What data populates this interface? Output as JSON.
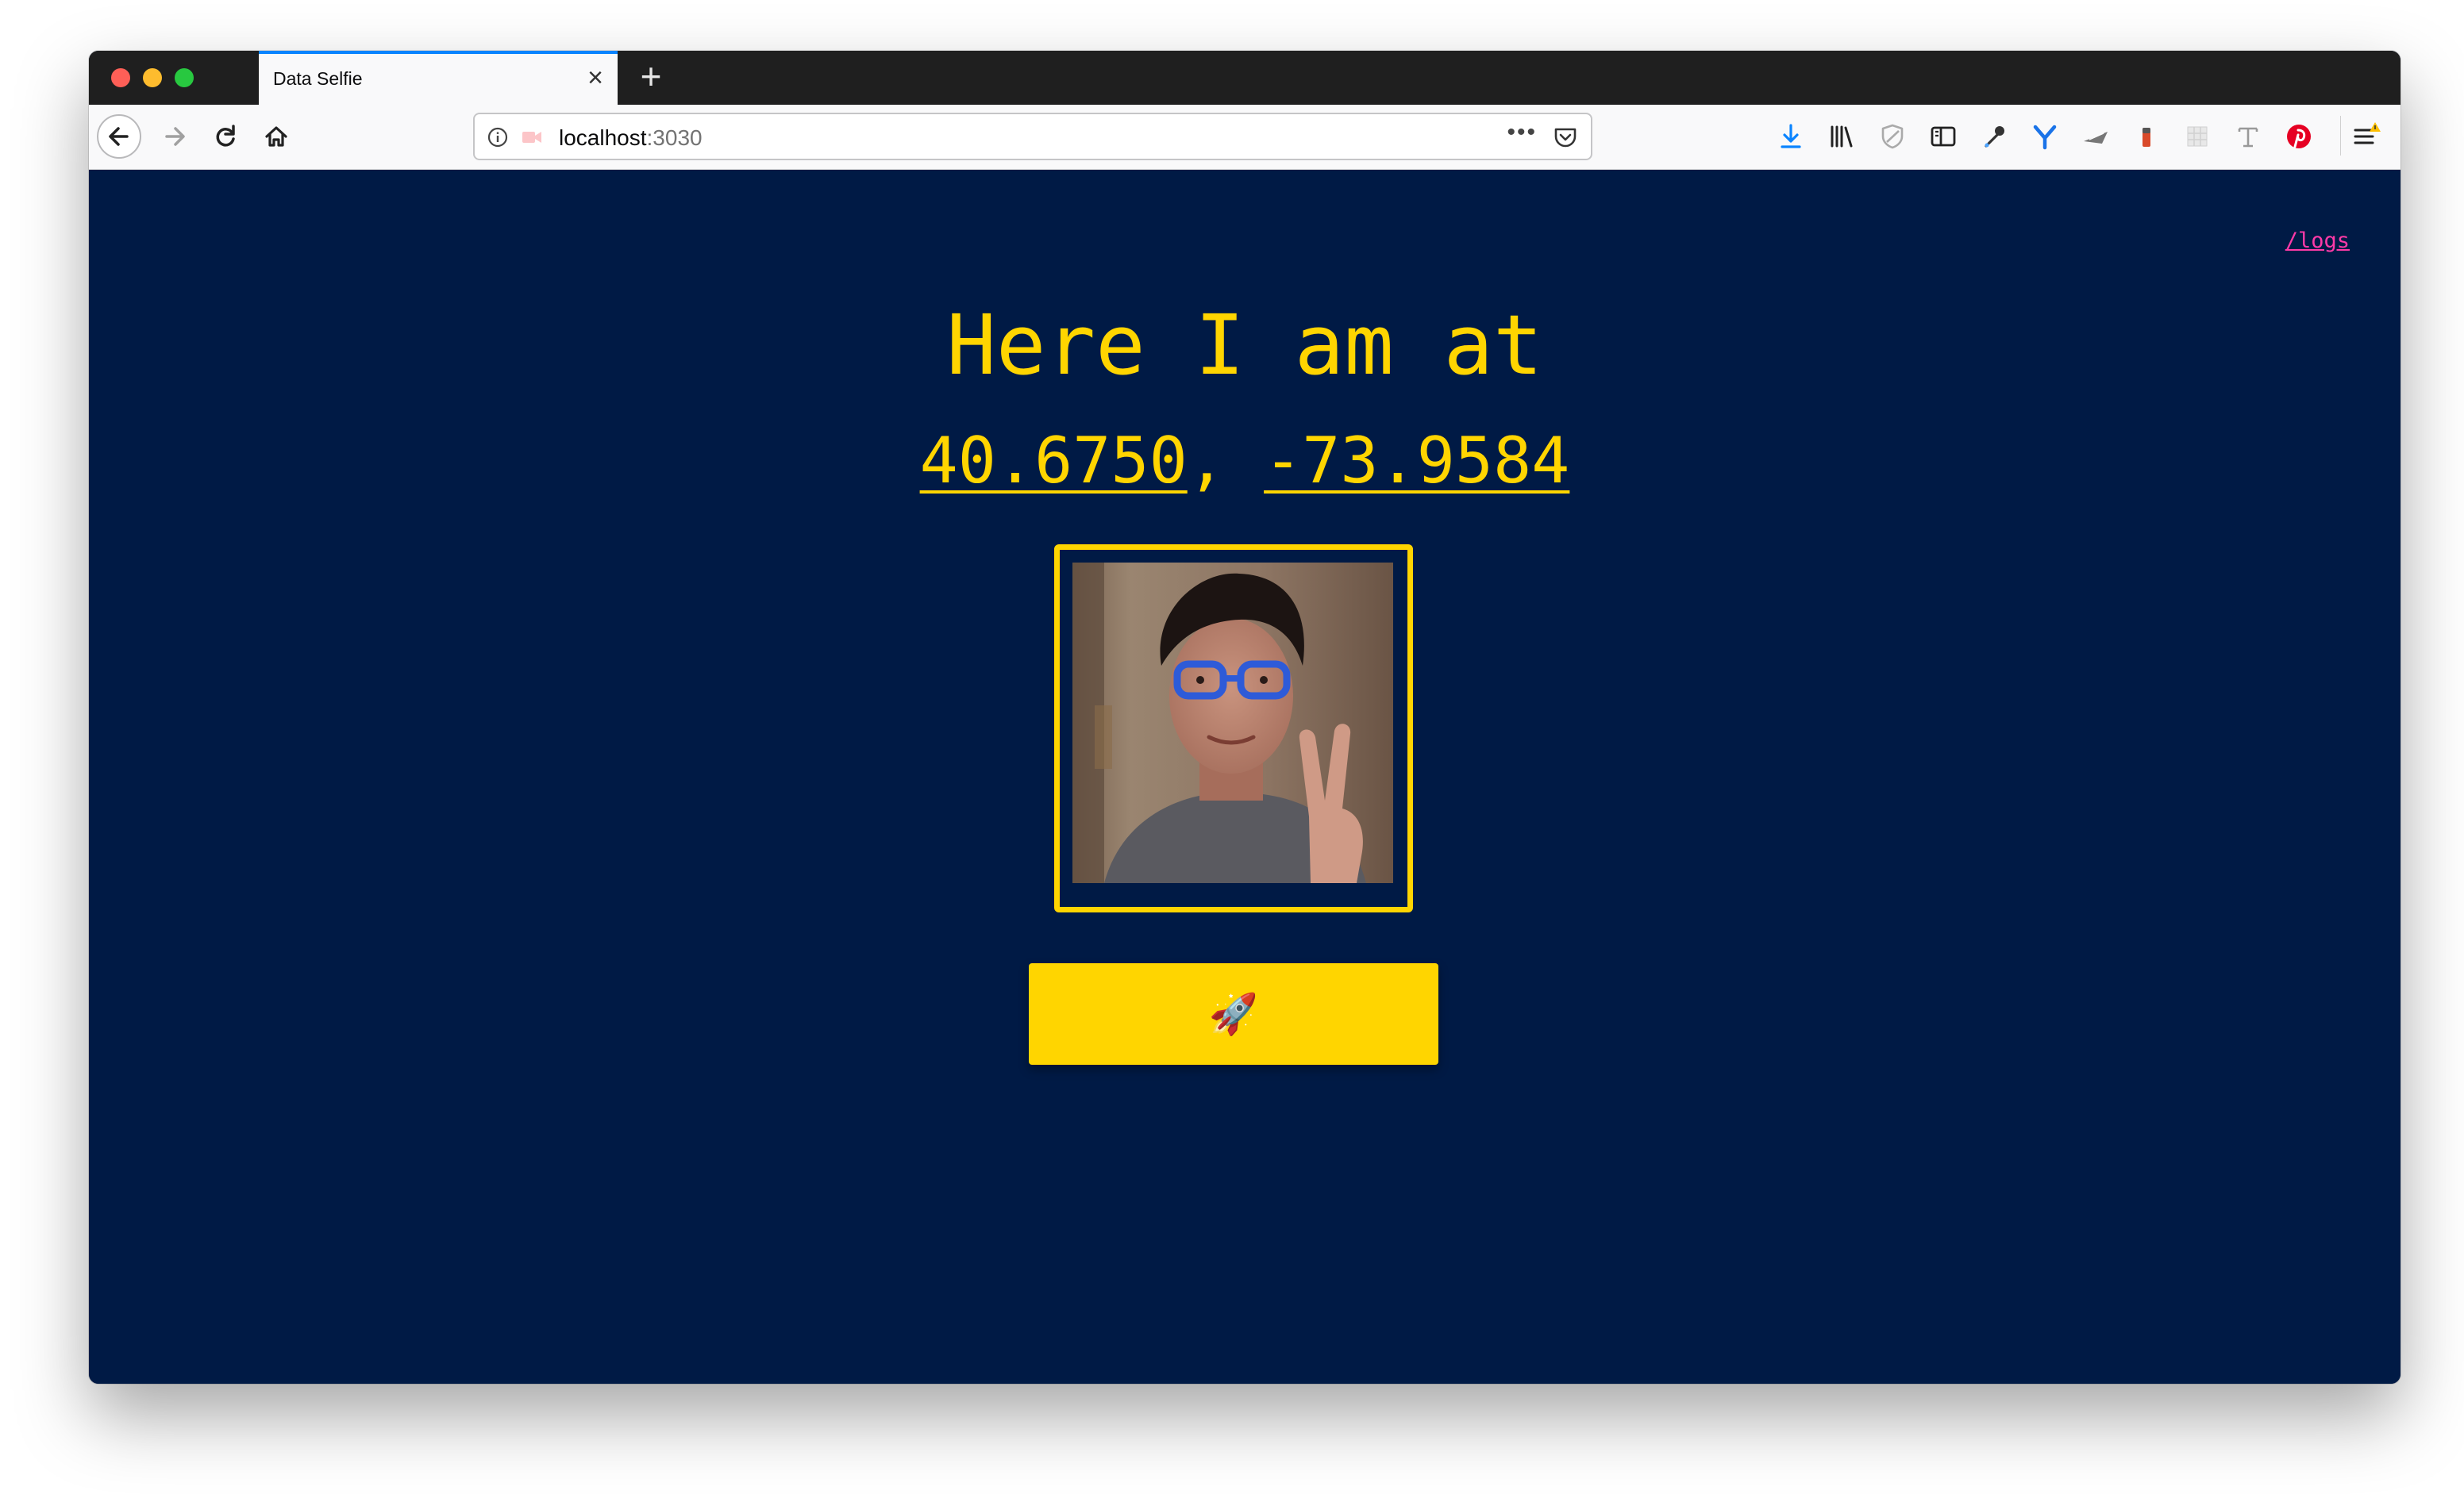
{
  "browser": {
    "tab_title": "Data Selfie",
    "tab_close": "×",
    "new_tab": "+",
    "url_host": "localhost",
    "url_port": ":3030",
    "url_more": "•••",
    "accent_color": "#0a84ff"
  },
  "toolbar_icons": [
    "download-icon",
    "library-icon",
    "tracking-shield-icon",
    "sidebar-icon",
    "eyedropper-icon",
    "extension-y-icon",
    "extension-plane-icon",
    "extension-battery-icon",
    "extension-grid-icon",
    "extension-t-icon",
    "pinterest-icon",
    "menu-icon"
  ],
  "page": {
    "logs_link": "/logs",
    "heading": "Here I am at",
    "latitude": "40.6750",
    "separator": ", ",
    "longitude": "-73.9584",
    "submit_label": "🚀",
    "colors": {
      "background": "#001a45",
      "accent": "#ffd500",
      "link": "#ff3aa8"
    }
  }
}
